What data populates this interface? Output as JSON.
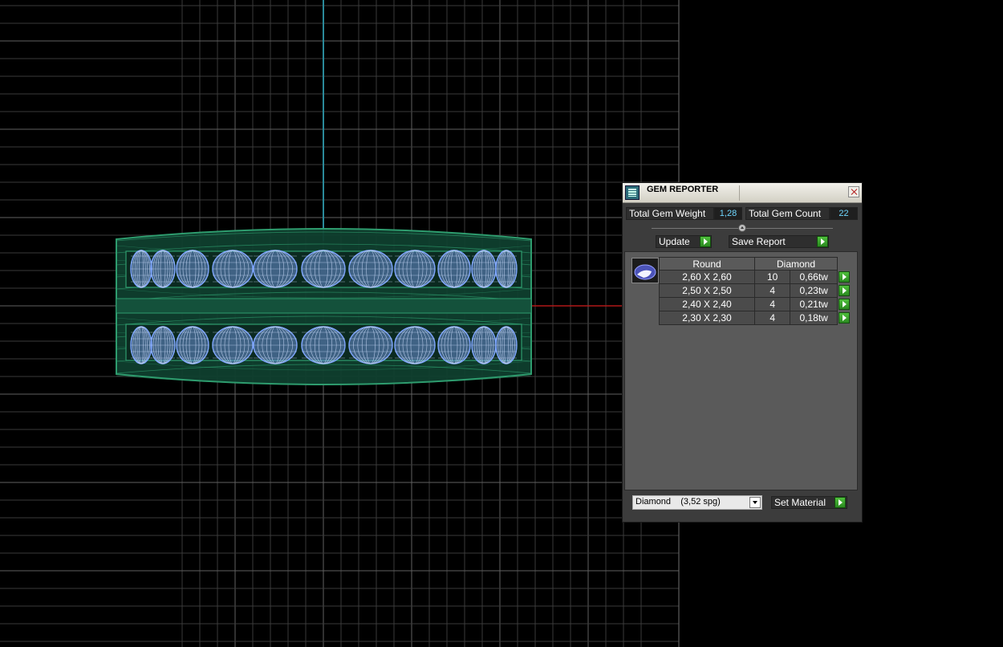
{
  "panel": {
    "title": "GEM REPORTER",
    "total_gem_weight_label": "Total Gem Weight",
    "total_gem_weight_value": "1,28",
    "total_gem_count_label": "Total Gem Count",
    "total_gem_count_value": "22",
    "update_label": "Update",
    "save_report_label": "Save Report",
    "table": {
      "headers": [
        "Round",
        "Diamond"
      ],
      "rows": [
        {
          "size": "2,60 X 2,60",
          "count": "10",
          "weight": "0,66tw"
        },
        {
          "size": "2,50 X 2,50",
          "count": "4",
          "weight": "0,23tw"
        },
        {
          "size": "2,40 X 2,40",
          "count": "4",
          "weight": "0,21tw"
        },
        {
          "size": "2,30 X 2,30",
          "count": "4",
          "weight": "0,18tw"
        }
      ]
    },
    "material_select_value": "Diamond    (3,52 spg)",
    "set_material_label": "Set Material"
  },
  "icons": {
    "app": "gem-reporter-app-icon",
    "close": "close-icon",
    "go": "green-arrow-icon",
    "gem": "round-gem-icon",
    "dropdown": "chevron-down-icon"
  },
  "colors": {
    "viewport_bg": "#000000",
    "grid_line": "#3a3a3a",
    "vertical_axis": "#2a8a9a",
    "horizontal_axis": "#b01818",
    "ring_wireframe": "#2e9c6e",
    "gems": "#7fa6ff",
    "panel_bg": "#3c3c3c",
    "value_text": "#6fd7ff",
    "go_button": "#3aa82c"
  }
}
